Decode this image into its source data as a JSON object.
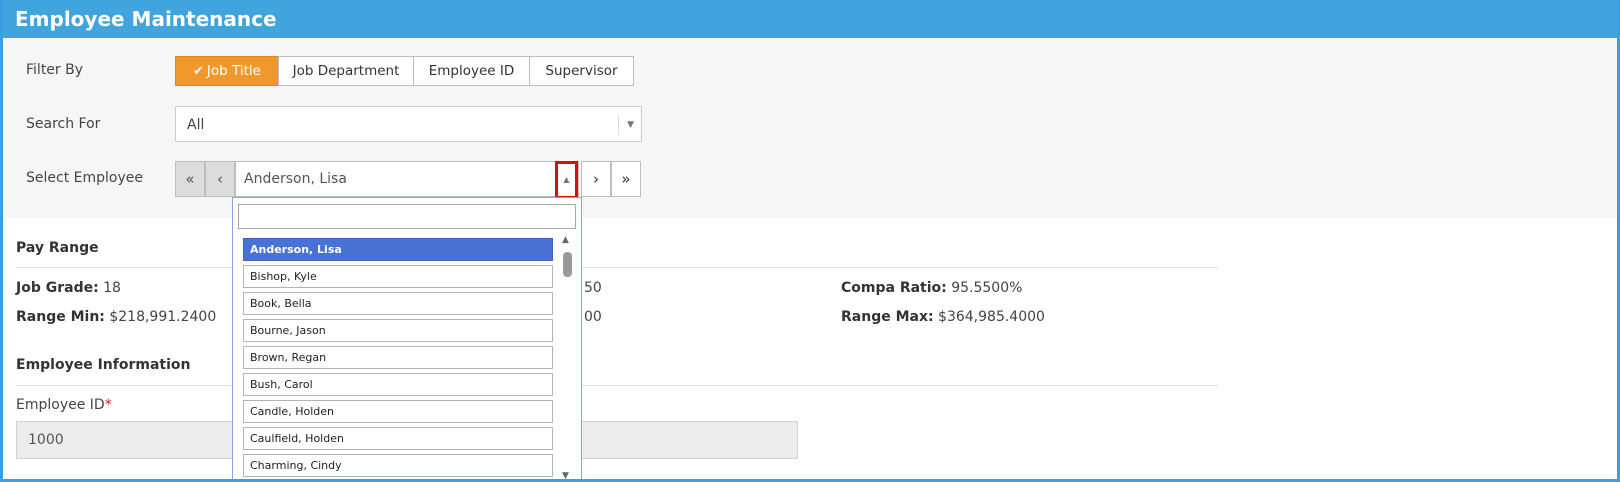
{
  "window": {
    "title": "Employee Maintenance"
  },
  "filter": {
    "label": "Filter By",
    "options": [
      {
        "label": "Job Title",
        "active": true
      },
      {
        "label": "Job Department",
        "active": false
      },
      {
        "label": "Employee ID",
        "active": false
      },
      {
        "label": "Supervisor",
        "active": false
      }
    ]
  },
  "search": {
    "label": "Search For",
    "value": "All"
  },
  "employee_select": {
    "label": "Select Employee",
    "value": "Anderson, Lisa",
    "first_glyph": "«",
    "prev_glyph": "‹",
    "next_glyph": "›",
    "last_glyph": "»",
    "toggle_glyph": "▲"
  },
  "pay_range": {
    "heading": "Pay Range",
    "job_grade_label": "Job Grade:",
    "job_grade_value": "18",
    "range_min_label": "Range Min:",
    "range_min_value": "$218,991.2400",
    "mid_row1_fragment": "50",
    "mid_row2_fragment": "00",
    "compa_ratio_label": "Compa Ratio:",
    "compa_ratio_value": "95.5500%",
    "range_max_label": "Range Max:",
    "range_max_value": "$364,985.4000"
  },
  "employee_info": {
    "heading": "Employee Information",
    "employee_id_label": "Employee ID",
    "required_mark": "*",
    "employee_id_value": "1000"
  },
  "dropdown": {
    "search_value": "",
    "items": [
      "Anderson, Lisa",
      "Bishop, Kyle",
      "Book, Bella",
      "Bourne, Jason",
      "Brown, Regan",
      "Bush, Carol",
      "Candle, Holden",
      "Caulfield, Holden",
      "Charming, Cindy"
    ],
    "selected_index": 0
  },
  "colors": {
    "title_bar": "#40a4de",
    "active_filter": "#f0982c",
    "selected_item": "#4872d4",
    "highlight_border": "#d80f0f"
  }
}
